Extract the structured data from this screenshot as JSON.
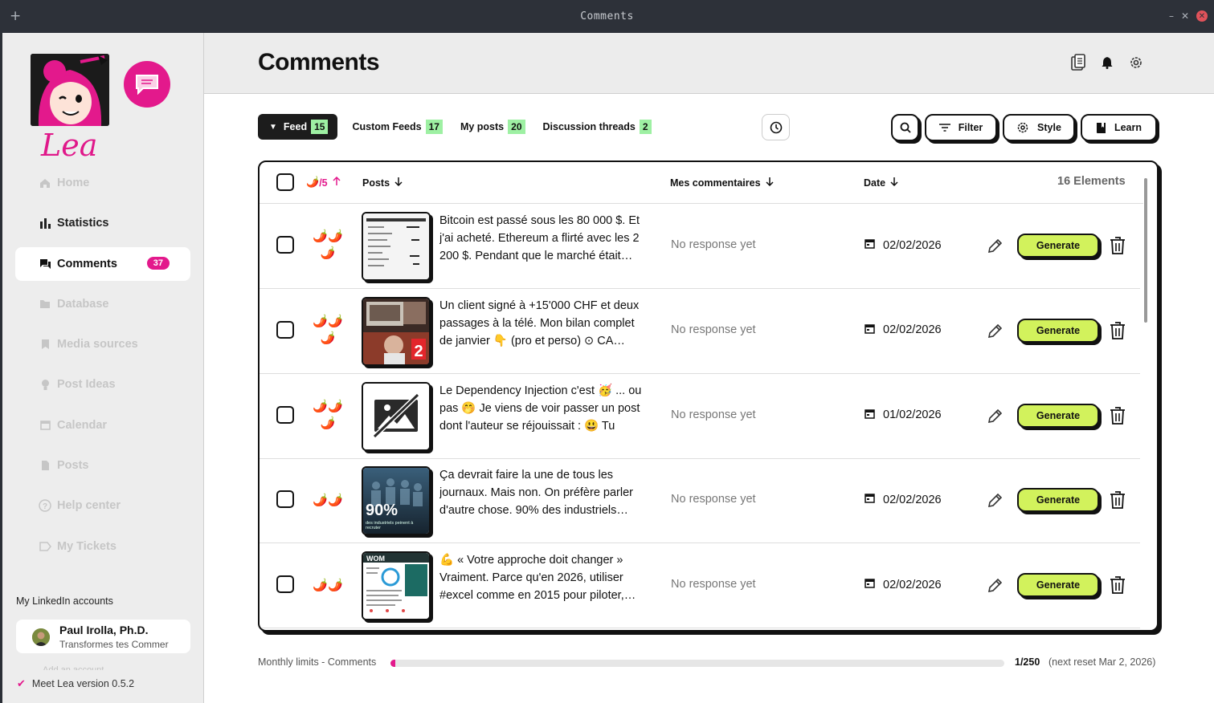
{
  "window": {
    "title": "Comments"
  },
  "brand": {
    "name": "Lea"
  },
  "sidebar": {
    "items": [
      {
        "label": "Home",
        "icon": "home-icon",
        "state": "disabled"
      },
      {
        "label": "Statistics",
        "icon": "bar-chart-icon",
        "state": "enabled"
      },
      {
        "label": "Comments",
        "icon": "comments-icon",
        "state": "active",
        "badge": "37"
      },
      {
        "label": "Database",
        "icon": "folder-icon",
        "state": "disabled"
      },
      {
        "label": "Media sources",
        "icon": "bookmark-icon",
        "state": "disabled"
      },
      {
        "label": "Post Ideas",
        "icon": "lightbulb-icon",
        "state": "disabled"
      },
      {
        "label": "Calendar",
        "icon": "calendar-icon",
        "state": "disabled"
      },
      {
        "label": "Posts",
        "icon": "document-icon",
        "state": "disabled"
      },
      {
        "label": "Help center",
        "icon": "help-icon",
        "state": "disabled"
      },
      {
        "label": "My Tickets",
        "icon": "tag-icon",
        "state": "disabled"
      }
    ],
    "linkedin_label": "My LinkedIn accounts",
    "account": {
      "name": "Paul Irolla, Ph.D.",
      "subtitle": "Transformes tes Commer"
    },
    "add_account": "Add an account",
    "version": "Meet Lea version 0.5.2"
  },
  "header": {
    "title": "Comments"
  },
  "tabs": [
    {
      "label": "Feed",
      "count": "15",
      "active": true
    },
    {
      "label": "Custom Feeds",
      "count": "17",
      "active": false
    },
    {
      "label": "My posts",
      "count": "20",
      "active": false
    },
    {
      "label": "Discussion threads",
      "count": "2",
      "active": false
    }
  ],
  "toolbar": {
    "filter": "Filter",
    "style": "Style",
    "learn": "Learn"
  },
  "table": {
    "headers": {
      "score": "/5",
      "posts": "Posts",
      "comments": "Mes commentaires",
      "date": "Date",
      "count": "16 Elements"
    },
    "rows": [
      {
        "chilis": 3,
        "text": "Bitcoin est passé sous les 80 000 $. Et j'ai acheté. Ethereum a flirté avec les 2 200 $. Pendant que le marché était…",
        "response": "No response yet",
        "date": "02/02/2026",
        "thumb": "document"
      },
      {
        "chilis": 3,
        "text": "Un client signé à +15'000 CHF et deux passages à la télé. Mon bilan complet de janvier 👇 (pro et perso) ⊙ CA…",
        "response": "No response yet",
        "date": "02/02/2026",
        "thumb": "tv"
      },
      {
        "chilis": 3,
        "text": "Le Dependency Injection c'est 🥳 ... ou pas 🤭 Je viens de voir passer un post dont l'auteur se réjouissait : 😃 Tu n'as…",
        "response": "No response yet",
        "date": "01/02/2026",
        "thumb": "none"
      },
      {
        "chilis": 2,
        "text": "Ça devrait faire la une de tous les journaux. Mais non. On préfère parler d'autre chose. 90% des industriels…",
        "response": "No response yet",
        "date": "02/02/2026",
        "thumb": "stat",
        "thumb_label": "90%",
        "thumb_sub": "des industriels peinent à recruter"
      },
      {
        "chilis": 2,
        "text": "💪 « Votre approche doit changer » Vraiment. Parce qu'en 2026, utiliser #excel comme en 2015 pour piloter,…",
        "response": "No response yet",
        "date": "02/02/2026",
        "thumb": "dashboard"
      }
    ],
    "generate_label": "Generate"
  },
  "limits": {
    "label": "Monthly limits - Comments",
    "used": 1,
    "total": 250,
    "count_text": "1/250",
    "reset_text": "(next reset Mar 2, 2026)"
  },
  "colors": {
    "accent": "#e3198c",
    "generate": "#d2f25c",
    "badge_green": "#9ef0a3",
    "dark": "#1c1c1c"
  }
}
